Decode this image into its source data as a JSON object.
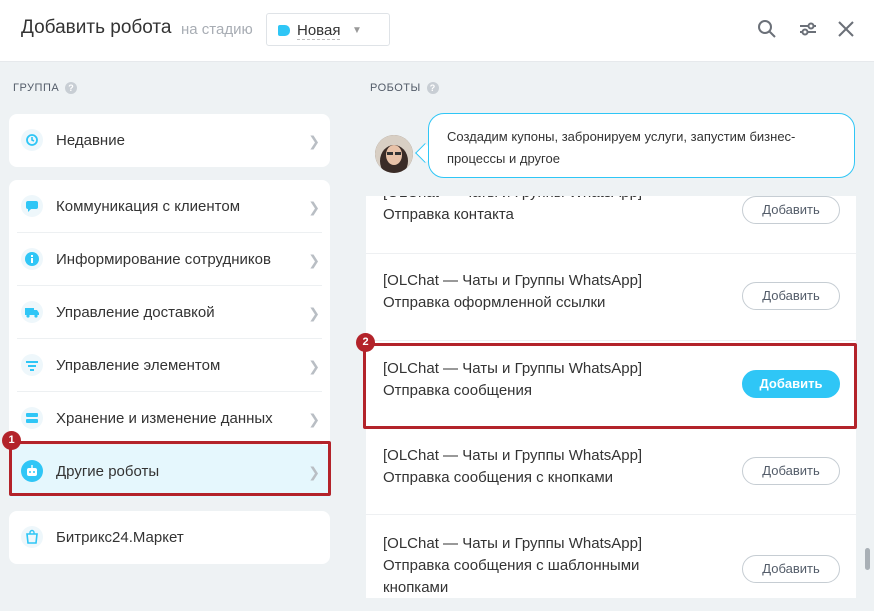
{
  "header": {
    "title": "Добавить робота",
    "stage_label": "на стадию",
    "stage_value": "Новая",
    "stage_color": "#2fc6f6",
    "icons": [
      "search-icon",
      "filter-settings-icon",
      "close-icon"
    ]
  },
  "groups": {
    "title": "ГРУППА",
    "recent": {
      "label": "Недавние",
      "icon": "history-icon"
    },
    "items": [
      {
        "label": "Коммуникация с клиентом",
        "icon": "chat-icon"
      },
      {
        "label": "Информирование сотрудников",
        "icon": "info-icon"
      },
      {
        "label": "Управление доставкой",
        "icon": "truck-icon"
      },
      {
        "label": "Управление элементом",
        "icon": "filter-icon"
      },
      {
        "label": "Хранение и изменение данных",
        "icon": "storage-icon"
      },
      {
        "label": "Другие роботы",
        "icon": "robot-icon",
        "active": true
      }
    ],
    "market": {
      "label": "Битрикс24.Маркет",
      "icon": "market-bag-icon"
    }
  },
  "robots": {
    "title": "РОБОТЫ",
    "hint": "Создадим купоны, забронируем услуги, запустим бизнес-процессы и другое",
    "items": [
      {
        "title": "[OLChat — Чаты и Группы WhatsApp]",
        "subtitle": "Отправка контакта",
        "button": "Добавить"
      },
      {
        "title": "[OLChat — Чаты и Группы WhatsApp]",
        "subtitle": "Отправка оформленной ссылки",
        "button": "Добавить"
      },
      {
        "title": "[OLChat — Чаты и Группы WhatsApp]",
        "subtitle": "Отправка сообщения",
        "button": "Добавить",
        "primary": true
      },
      {
        "title": "[OLChat — Чаты и Группы WhatsApp]",
        "subtitle": "Отправка сообщения с кнопками",
        "button": "Добавить"
      },
      {
        "title": "[OLChat — Чаты и Группы WhatsApp]",
        "subtitle": "Отправка сообщения с шаблонными",
        "subtitle2": "кнопками",
        "button": "Добавить"
      }
    ]
  },
  "annotations": {
    "badge1": "1",
    "badge2": "2",
    "highlight_color": "#b3232a"
  }
}
